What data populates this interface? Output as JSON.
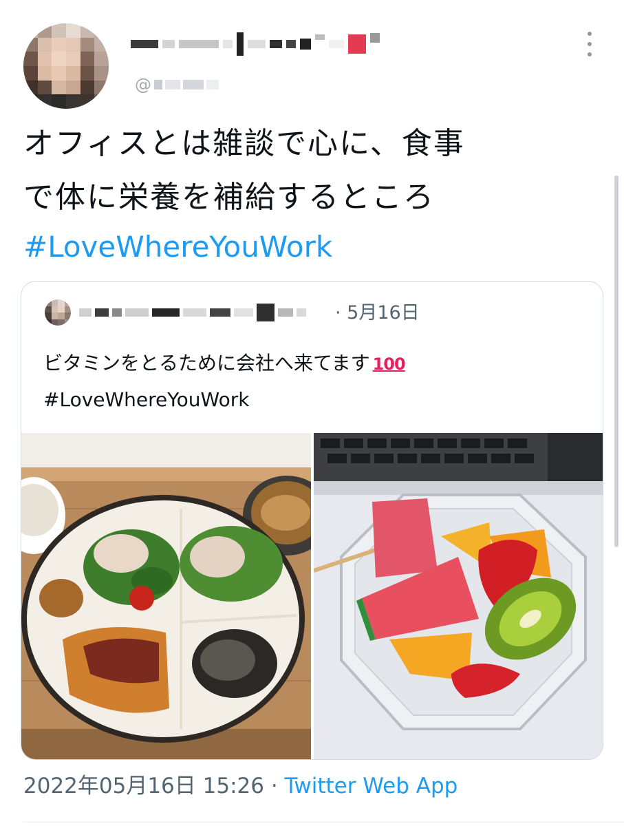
{
  "author": {
    "avatar_icon": "user-avatar-pixelated",
    "handle_prefix": "@"
  },
  "menu": {
    "more_icon": "more-vertical-icon"
  },
  "tweet": {
    "line1": "オフィスとは雑談で心に、食事",
    "line2": "で体に栄養を補給するところ",
    "hashtag": "#LoveWhereYouWork"
  },
  "quoted": {
    "avatar_icon": "user-avatar-pixelated",
    "date": "· 5月16日",
    "text": "ビタミンをとるために会社へ来てます",
    "emoji": "100",
    "hashtag": "#LoveWhereYouWork",
    "photos": [
      "lunch-plate-photo",
      "fruit-cup-photo"
    ]
  },
  "footer": {
    "timestamp": "2022年05月16日 15:26",
    "separator": " · ",
    "source": "Twitter Web App"
  },
  "colors": {
    "link": "#1d9bf0",
    "text": "#0f1419",
    "secondary": "#536471",
    "border": "#cfd9de"
  }
}
